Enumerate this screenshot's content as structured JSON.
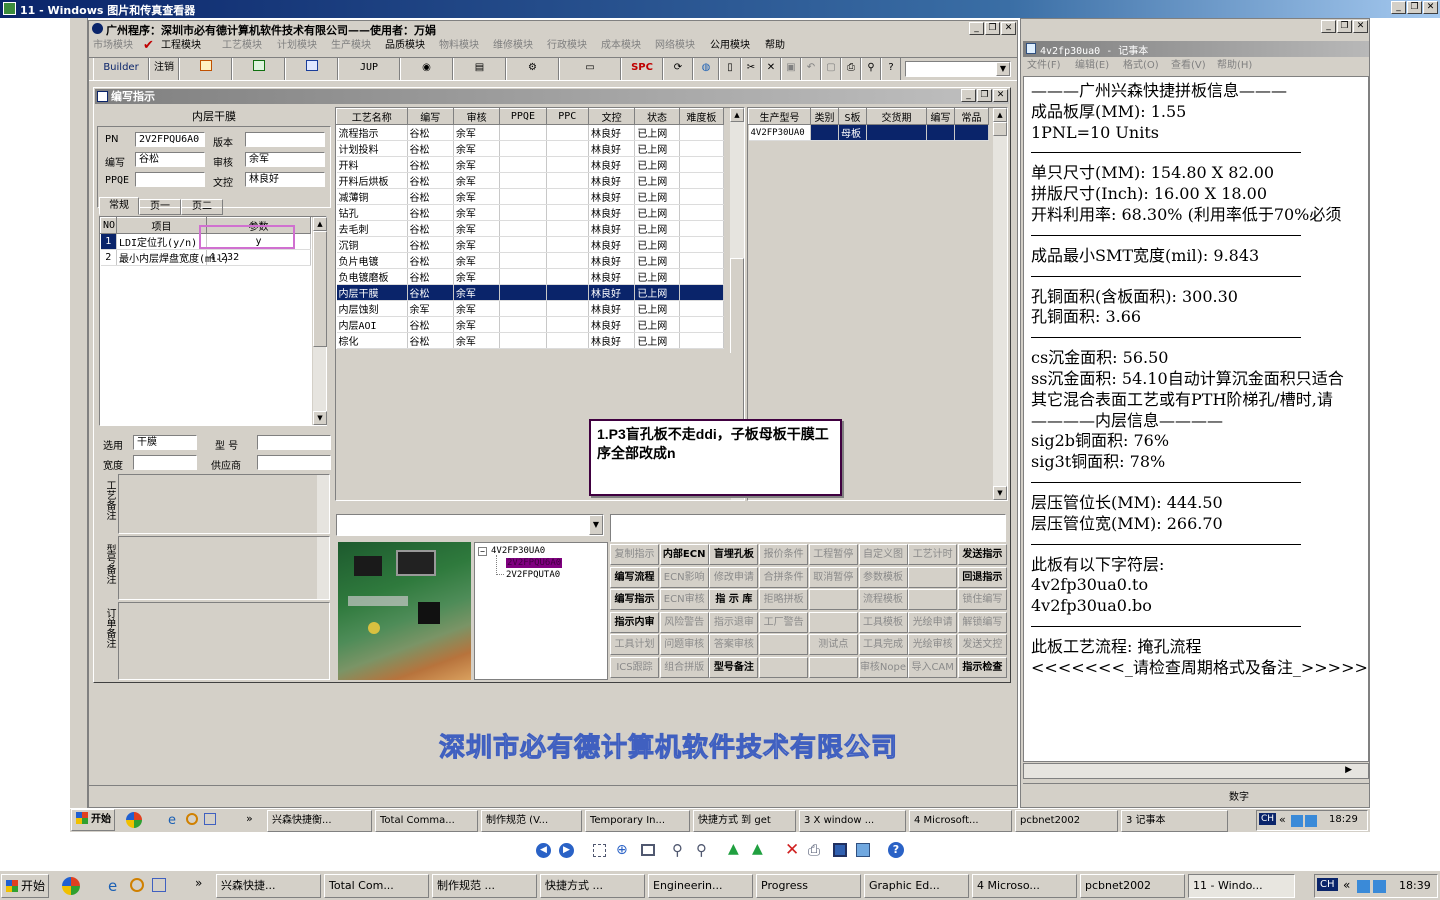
{
  "viewer": {
    "title": "11 - Windows 图片和传真查看器",
    "toolbar_icons": [
      "prev-icon",
      "next-icon",
      "best-fit-icon",
      "actual-size-icon",
      "slideshow-icon",
      "zoom-in-icon",
      "zoom-out-icon",
      "rotate-cw-icon",
      "rotate-ccw-icon",
      "delete-icon",
      "print-icon",
      "save-icon",
      "edit-icon",
      "help-icon"
    ]
  },
  "app": {
    "title": "广州程序：深圳市必有德计算机软件技术有限公司——使用者：万娟",
    "menu": [
      "市场模块",
      "工程模块",
      "工艺模块",
      "计划模块",
      "生产模块",
      "品质模块",
      "物料模块",
      "维修模块",
      "行政模块",
      "成本模块",
      "网络模块",
      "公用模块",
      "帮助"
    ],
    "toolbar": {
      "builder": "Builder",
      "logout": "注销",
      "jup": "JUP",
      "spc": "SPC"
    },
    "watermark": "深圳市必有德计算机软件技术有限公司"
  },
  "dialog": {
    "title": "编写指示",
    "section_title": "内层干膜",
    "pn_label": "PN",
    "pn_value": "2V2FPQU6A0",
    "version_label": "版本",
    "version_value": "",
    "writer_label": "编写",
    "writer_value": "谷松",
    "reviewer_label": "审核",
    "reviewer_value": "余军",
    "ppqe_label": "PPQE",
    "ppqe_value": "",
    "control_label": "文控",
    "control_value": "林良好",
    "tabs": [
      "常规",
      "页一",
      "页二"
    ],
    "param_headers": [
      "NO",
      "项目",
      "参数"
    ],
    "params": [
      {
        "no": "1",
        "item": "LDI定位孔(y/n)",
        "value": "y"
      },
      {
        "no": "2",
        "item": "最小内层焊盘宽度(mil)",
        "value": "4.232"
      }
    ],
    "select_label": "选用",
    "select_value": "干膜",
    "model_label": "型  号",
    "model_value": "",
    "width_label": "宽度",
    "width_value": "",
    "supplier_label": "供应商",
    "supplier_value": "",
    "notes": [
      "工艺备注",
      "型号备注",
      "订单备注"
    ],
    "process_headers": [
      "工艺名称",
      "编写",
      "审核",
      "PPQE",
      "PPC",
      "文控",
      "状态",
      "难度板"
    ],
    "processes": [
      [
        "流程指示",
        "谷松",
        "余军",
        "",
        "",
        "林良好",
        "已上网",
        ""
      ],
      [
        "计划投料",
        "谷松",
        "余军",
        "",
        "",
        "林良好",
        "已上网",
        ""
      ],
      [
        "开料",
        "谷松",
        "余军",
        "",
        "",
        "林良好",
        "已上网",
        ""
      ],
      [
        "开料后烘板",
        "谷松",
        "余军",
        "",
        "",
        "林良好",
        "已上网",
        ""
      ],
      [
        "减薄铜",
        "谷松",
        "余军",
        "",
        "",
        "林良好",
        "已上网",
        ""
      ],
      [
        "钻孔",
        "谷松",
        "余军",
        "",
        "",
        "林良好",
        "已上网",
        ""
      ],
      [
        "去毛刺",
        "谷松",
        "余军",
        "",
        "",
        "林良好",
        "已上网",
        ""
      ],
      [
        "沉铜",
        "谷松",
        "余军",
        "",
        "",
        "林良好",
        "已上网",
        ""
      ],
      [
        "负片电镀",
        "谷松",
        "余军",
        "",
        "",
        "林良好",
        "已上网",
        ""
      ],
      [
        "负电镀磨板",
        "谷松",
        "余军",
        "",
        "",
        "林良好",
        "已上网",
        ""
      ],
      [
        "内层干膜",
        "谷松",
        "余军",
        "",
        "",
        "林良好",
        "已上网",
        ""
      ],
      [
        "内层蚀刻",
        "余军",
        "余军",
        "",
        "",
        "林良好",
        "已上网",
        ""
      ],
      [
        "内层AOI",
        "谷松",
        "余军",
        "",
        "",
        "林良好",
        "已上网",
        ""
      ],
      [
        "棕化",
        "谷松",
        "余军",
        "",
        "",
        "林良好",
        "已上网",
        ""
      ]
    ],
    "selected_process": 10,
    "product_headers": [
      "生产型号",
      "类别",
      "S板",
      "交货期",
      "编写",
      "常品"
    ],
    "products": [
      [
        "4V2FP30UA0",
        "",
        "母板",
        "",
        "",
        ""
      ]
    ],
    "annotation": "1.P3盲孔板不走ddi，子板母板干膜工序全部改成n",
    "tree": {
      "root": "4V2FP30UA0",
      "child1": "2V2FPQU6A0",
      "child2": "2V2FPQUTA0"
    },
    "actions": [
      [
        {
          "t": "复制指示",
          "on": false
        },
        {
          "t": "内部ECN",
          "on": true
        },
        {
          "t": "盲埋孔板",
          "on": true
        },
        {
          "t": "报价条件",
          "on": false
        },
        {
          "t": "工程暂停",
          "on": false
        },
        {
          "t": "自定义图",
          "on": false
        },
        {
          "t": "工艺计时",
          "on": false
        },
        {
          "t": "发送指示",
          "on": true
        }
      ],
      [
        {
          "t": "编写流程",
          "on": true
        },
        {
          "t": "ECN影响",
          "on": false
        },
        {
          "t": "修改申请",
          "on": false
        },
        {
          "t": "合拼条件",
          "on": false
        },
        {
          "t": "取消暂停",
          "on": false
        },
        {
          "t": "参数模板",
          "on": false
        },
        {
          "t": "",
          "on": false
        },
        {
          "t": "回退指示",
          "on": true
        }
      ],
      [
        {
          "t": "编写指示",
          "on": true
        },
        {
          "t": "ECN审核",
          "on": false
        },
        {
          "t": "指 示 库",
          "on": true
        },
        {
          "t": "拒略拼板",
          "on": false
        },
        {
          "t": "",
          "on": false
        },
        {
          "t": "流程模板",
          "on": false
        },
        {
          "t": "",
          "on": false
        },
        {
          "t": "锁住编写",
          "on": false
        }
      ],
      [
        {
          "t": "指示内审",
          "on": true
        },
        {
          "t": "风险警告",
          "on": false
        },
        {
          "t": "指示退审",
          "on": false
        },
        {
          "t": "工厂警告",
          "on": false
        },
        {
          "t": "",
          "on": false
        },
        {
          "t": "工具模板",
          "on": false
        },
        {
          "t": "光绘申请",
          "on": false
        },
        {
          "t": "解锁编写",
          "on": false
        }
      ],
      [
        {
          "t": "工具计划",
          "on": false
        },
        {
          "t": "问题审核",
          "on": false
        },
        {
          "t": "答案审核",
          "on": false
        },
        {
          "t": "",
          "on": false
        },
        {
          "t": "测试点",
          "on": false
        },
        {
          "t": "工具完成",
          "on": false
        },
        {
          "t": "光绘审核",
          "on": false
        },
        {
          "t": "发送文控",
          "on": false
        }
      ],
      [
        {
          "t": "ICS跟踪",
          "on": false
        },
        {
          "t": "组合拼版",
          "on": false
        },
        {
          "t": "型号备注",
          "on": true
        },
        {
          "t": "",
          "on": false
        },
        {
          "t": "",
          "on": false
        },
        {
          "t": "审核Nope",
          "on": false
        },
        {
          "t": "导入CAM",
          "on": false
        },
        {
          "t": "指示检查",
          "on": true
        }
      ]
    ]
  },
  "notepad": {
    "title": "4v2fp30ua0 - 记事本",
    "menu": [
      "文件(F)",
      "编辑(E)",
      "格式(O)",
      "查看(V)",
      "帮助(H)"
    ],
    "status": "数字",
    "blocks": [
      [
        "———广州兴森快捷拼板信息———",
        "成品板厚(MM): 1.55",
        "1PNL=10 Units"
      ],
      [
        "单只尺寸(MM): 154.80 X 82.00",
        "拼版尺寸(Inch): 16.00 X 18.00",
        "开料利用率: 68.30% (利用率低于70%必须"
      ],
      [
        "成品最小SMT宽度(mil): 9.843"
      ],
      [
        "孔铜面积(含板面积): 300.30",
        "孔铜面积: 3.66"
      ],
      [
        "cs沉金面积: 56.50",
        "ss沉金面积: 54.10自动计算沉金面积只适合",
        "其它混合表面工艺或有PTH阶梯孔/槽时,请",
        "————内层信息————",
        "sig2b铜面积: 76%",
        "sig3t铜面积: 78%"
      ],
      [
        "层压管位长(MM): 444.50",
        "层压管位宽(MM): 266.70"
      ],
      [
        "此板有以下字符层:",
        "4v2fp30ua0.to",
        "4v2fp30ua0.bo"
      ],
      [
        "此板工艺流程: 掩孔流程",
        "<<<<<<<_请检查周期格式及备注_>>>>>>"
      ]
    ]
  },
  "inner_taskbar": {
    "start": "开始",
    "items": [
      "兴森快捷衡...",
      "Total Comma...",
      "制作规范 (V...",
      "Temporary In...",
      "快捷方式 到 get",
      "3 X window ...",
      "4 Microsoft...",
      "pcbnet2002",
      "3 记事本"
    ],
    "ime": "CH",
    "time": "18:29"
  },
  "outer_taskbar": {
    "start": "开始",
    "items": [
      "兴森快捷...",
      "Total Com...",
      "制作规范 ...",
      "快捷方式 ...",
      "Engineerin...",
      "Progress",
      "Graphic Ed...",
      "4 Microso...",
      "pcbnet2002",
      "11 - Windo..."
    ],
    "ime": "CH",
    "time": "18:39"
  }
}
